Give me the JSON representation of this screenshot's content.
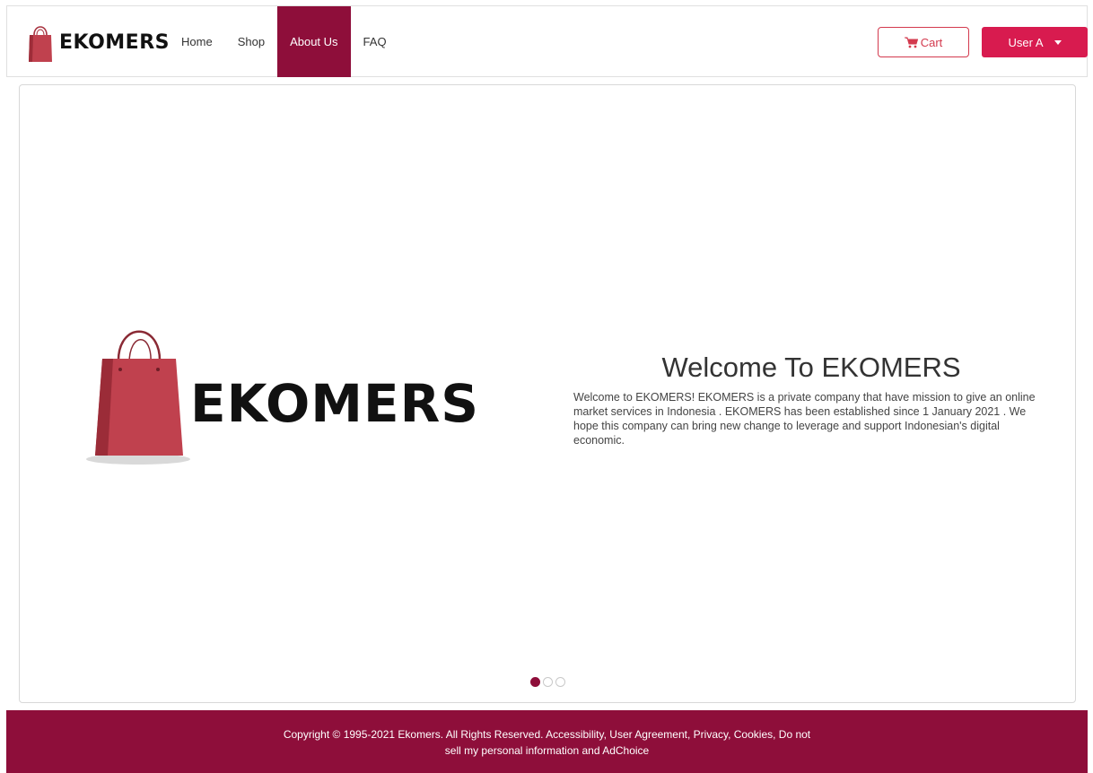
{
  "brand": {
    "name": "EKOMERS"
  },
  "nav": {
    "links": [
      {
        "label": "Home"
      },
      {
        "label": "Shop"
      },
      {
        "label": "About Us"
      },
      {
        "label": "FAQ"
      }
    ],
    "active": "About Us"
  },
  "header": {
    "cart_label": "Cart",
    "user_label": "User A"
  },
  "hero": {
    "logo_text": "EKOMERS",
    "title": "Welcome To EKOMERS",
    "text": "Welcome to EKOMERS! EKOMERS is a private company that have mission to give an online market services in Indonesia . EKOMERS has been established since 1 January 2021 . We hope this company can bring new change to leverage and support Indonesian's digital economic.",
    "slide_count": 3,
    "active_slide": 1
  },
  "footer": {
    "text": "Copyright © 1995-2021 Ekomers. All Rights Reserved. Accessibility, User Agreement, Privacy, Cookies, Do not sell my personal information and AdChoice"
  },
  "colors": {
    "brand_maroon": "#8e0e3a",
    "accent_red": "#d81b4f",
    "bag_red": "#c0414e"
  },
  "icons": [
    "shopping-bag-icon",
    "cart-icon",
    "caret-down-icon"
  ]
}
